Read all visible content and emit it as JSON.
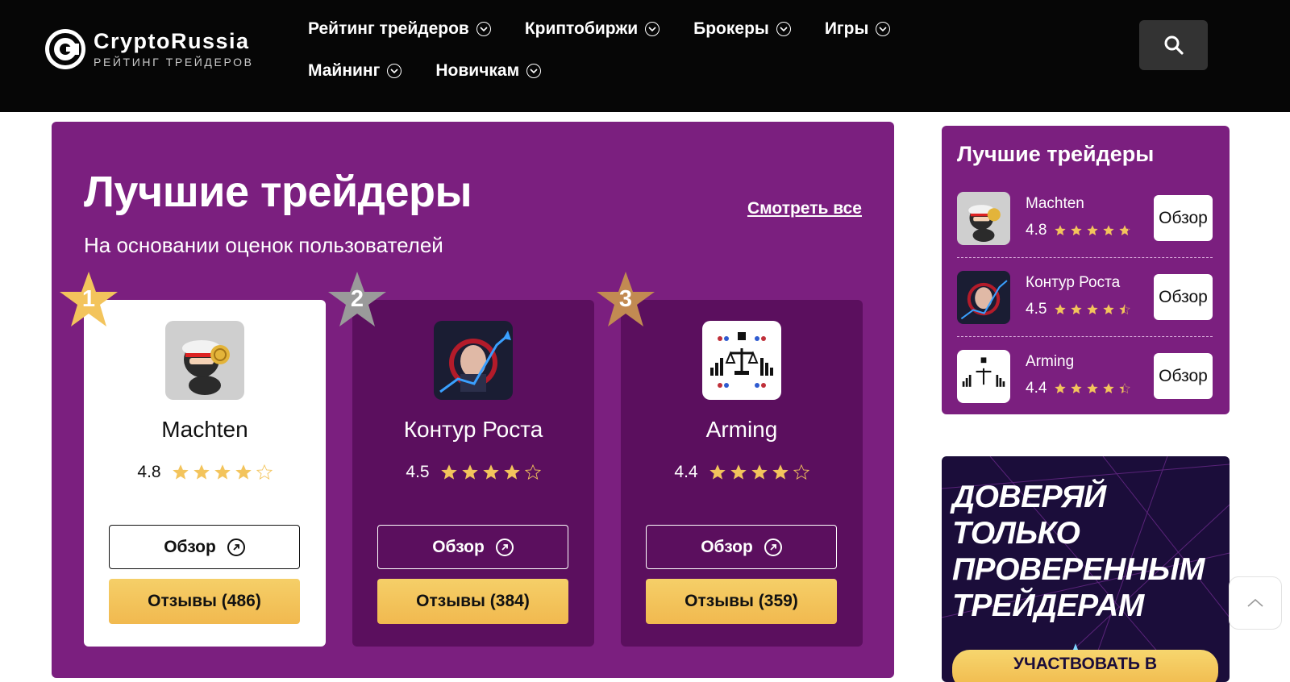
{
  "logo": {
    "title": "CryptoRussia",
    "subtitle": "РЕЙТИНГ ТРЕЙДЕРОВ"
  },
  "nav": [
    {
      "label": "Рейтинг трейдеров"
    },
    {
      "label": "Криптобиржи"
    },
    {
      "label": "Брокеры"
    },
    {
      "label": "Игры"
    },
    {
      "label": "Майнинг"
    },
    {
      "label": "Новичкам"
    }
  ],
  "hero": {
    "title": "Лучшие трейдеры",
    "subtitle": "На основании оценок пользователей",
    "see_all": "Смотреть все"
  },
  "cards": [
    {
      "rank": "1",
      "name": "Machten",
      "rating": "4.8",
      "stars": 4,
      "review_label": "Обзор",
      "reviews_label": "Отзывы (486)"
    },
    {
      "rank": "2",
      "name": "Контур Роста",
      "rating": "4.5",
      "stars": 4,
      "review_label": "Обзор",
      "reviews_label": "Отзывы (384)"
    },
    {
      "rank": "3",
      "name": "Arming",
      "rating": "4.4",
      "stars": 4,
      "review_label": "Обзор",
      "reviews_label": "Отзывы (359)"
    }
  ],
  "sidebar": {
    "title": "Лучшие трейдеры",
    "items": [
      {
        "name": "Machten",
        "rating": "4.8",
        "stars": 4.8,
        "button": "Обзор"
      },
      {
        "name": "Контур Роста",
        "rating": "4.5",
        "stars": 4.5,
        "button": "Обзор"
      },
      {
        "name": "Arming",
        "rating": "4.4",
        "stars": 4.4,
        "button": "Обзор"
      }
    ]
  },
  "banner": {
    "line1": "ДОВЕРЯЙ",
    "line2": "ТОЛЬКО",
    "line3": "ПРОВЕРЕННЫМ",
    "line4": "ТРЕЙДЕРАМ",
    "button": "УЧАСТВОВАТЬ В"
  },
  "colors": {
    "brand_purple": "#7b1f7f",
    "card_dark": "#5b0f5e",
    "gold": "#f3c45c",
    "silver": "#9a9a9a",
    "bronze": "#c28a52",
    "star": "#f3c45c"
  },
  "icons": {
    "search": "search-icon",
    "scroll_top": "chevron-up-icon"
  }
}
